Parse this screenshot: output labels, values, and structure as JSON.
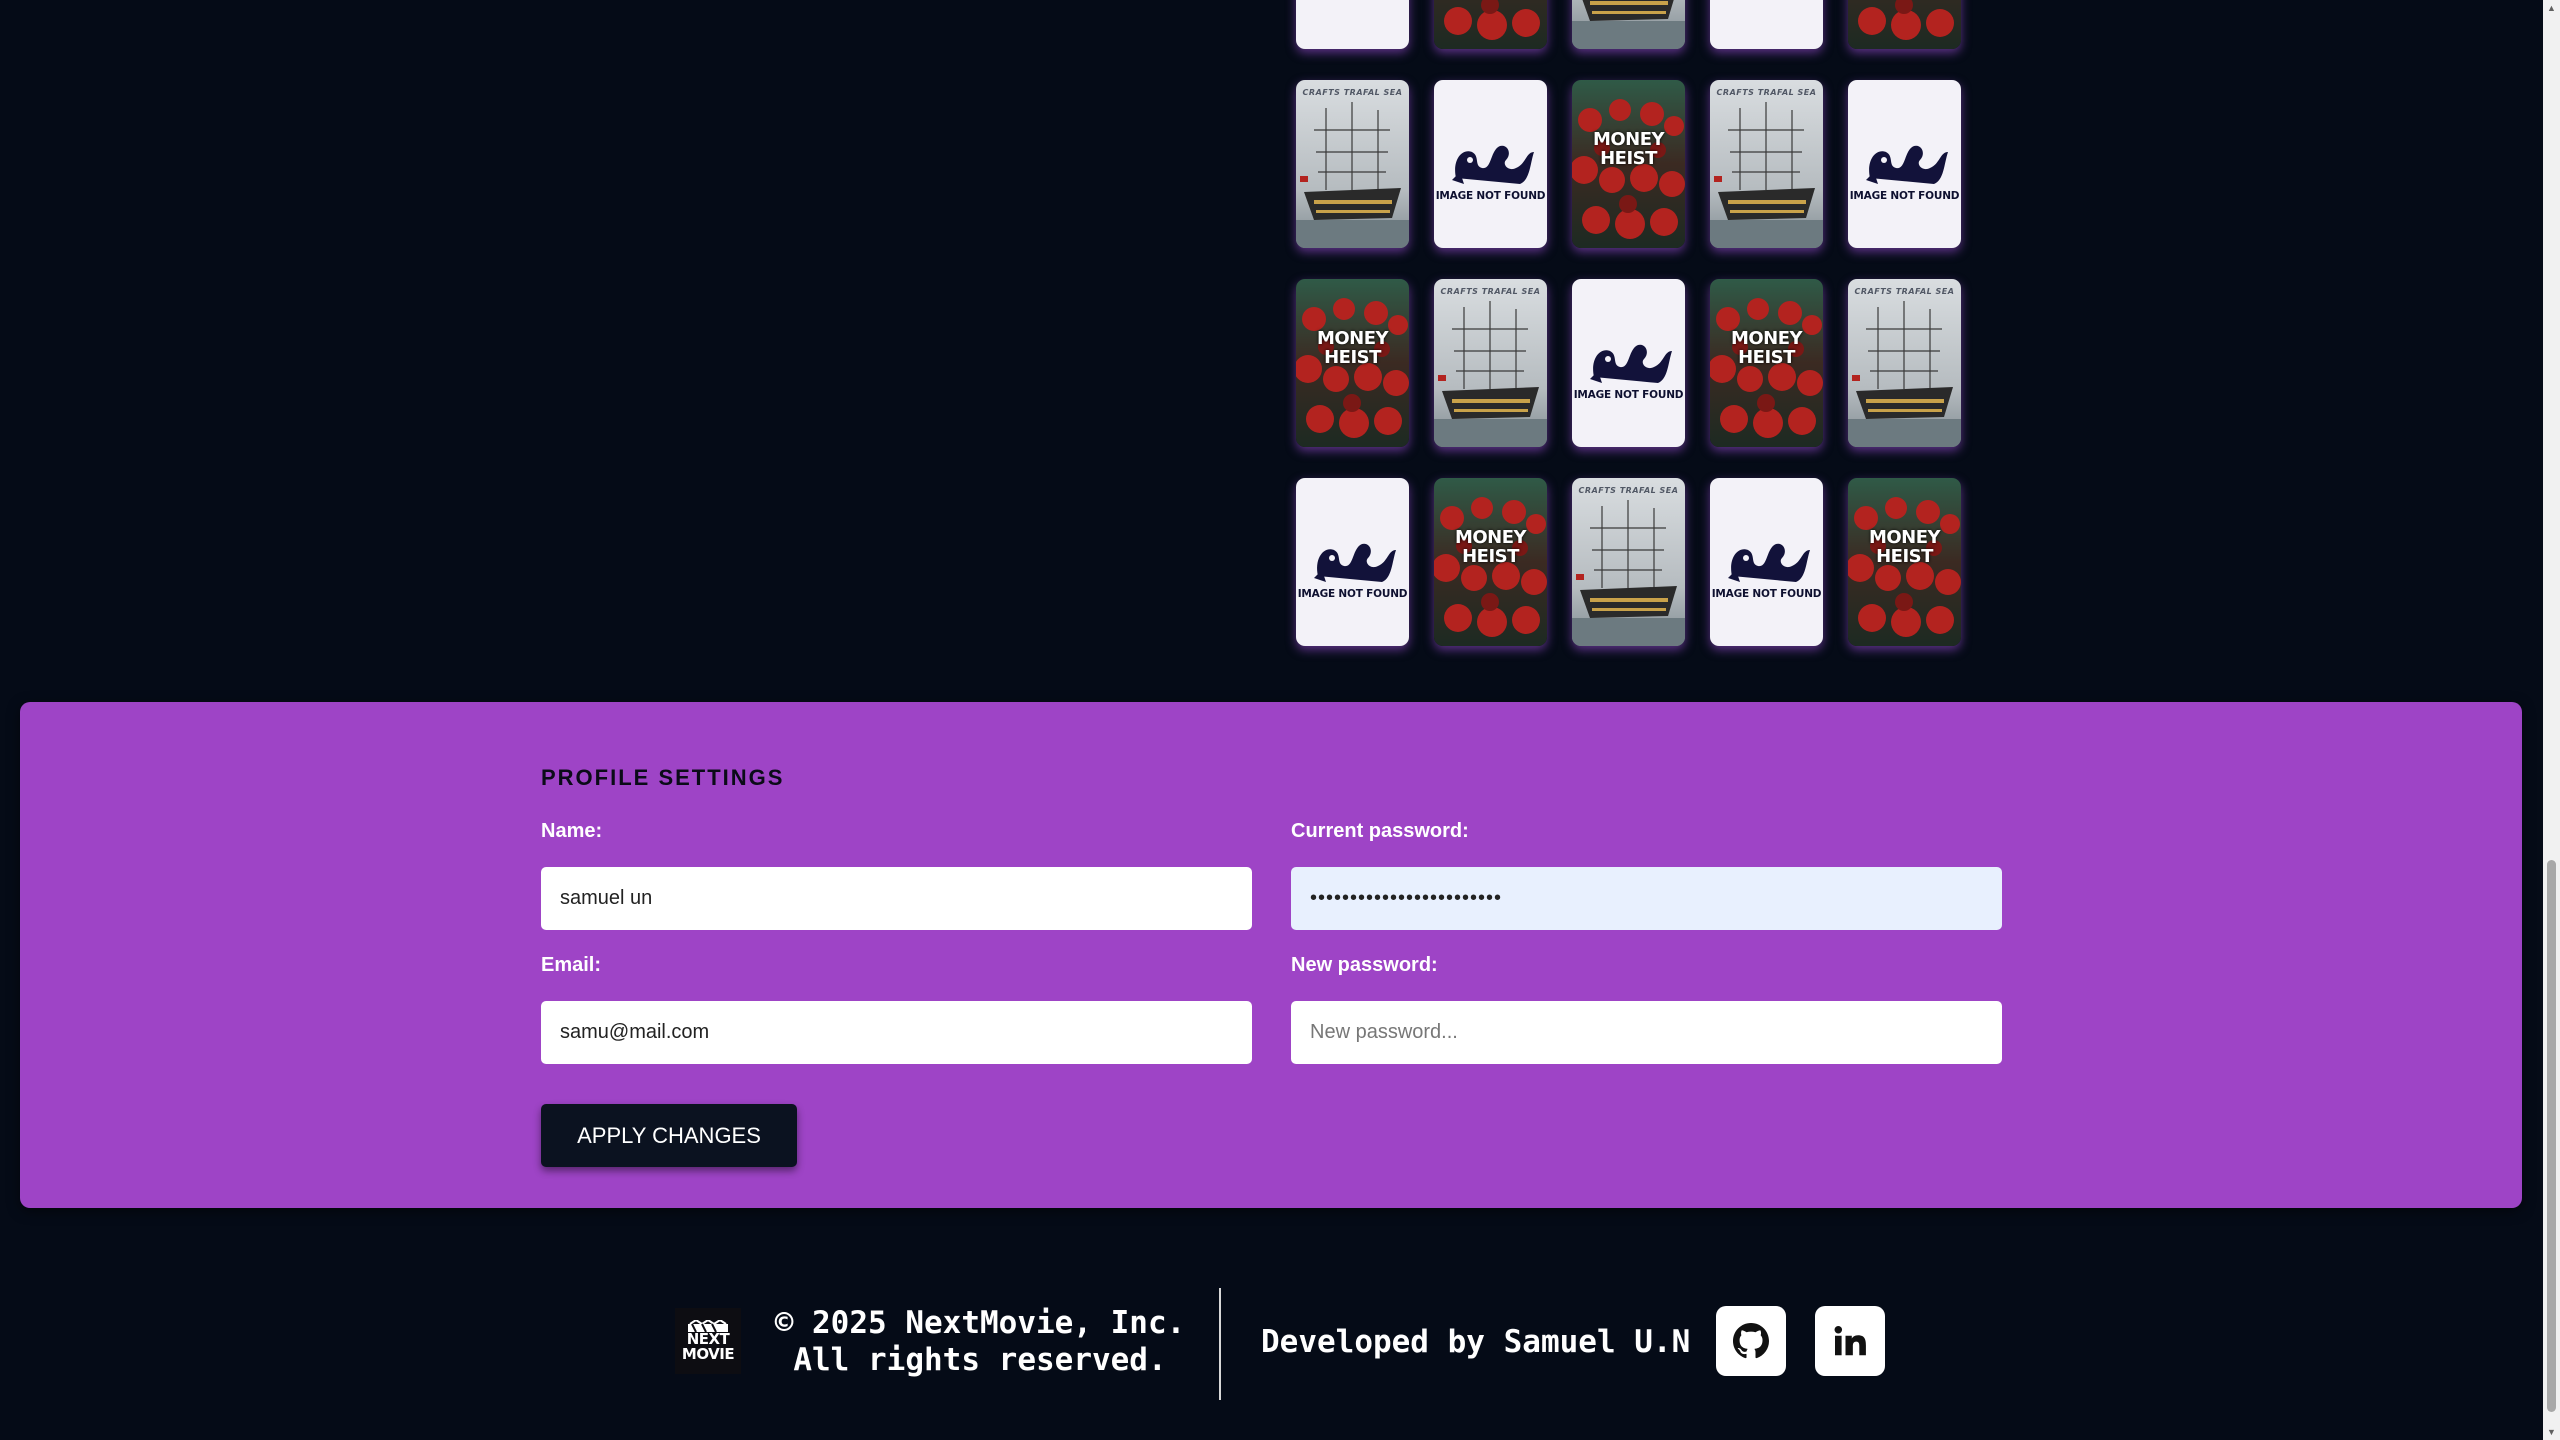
{
  "posters": {
    "rows": [
      [
        "not_found",
        "heist",
        "ship",
        "not_found",
        "heist"
      ],
      [
        "ship",
        "not_found",
        "heist",
        "ship",
        "not_found"
      ],
      [
        "heist",
        "ship",
        "not_found",
        "heist",
        "ship"
      ],
      [
        "not_found",
        "heist",
        "ship",
        "not_found",
        "heist"
      ]
    ],
    "not_found_caption": "IMAGE NOT FOUND",
    "heist_caption_line1": "MONEY",
    "heist_caption_line2": "HEIST",
    "ship_caption": "CRAFTS TRAFAL SEA"
  },
  "settings": {
    "title": "PROFILE SETTINGS",
    "name_label": "Name:",
    "name_value": "samuel un",
    "email_label": "Email:",
    "email_value": "samu@mail.com",
    "current_password_label": "Current password:",
    "current_password_value": "••••••••••••••••••••••••",
    "new_password_label": "New password:",
    "new_password_placeholder": "New password...",
    "apply_label": "APPLY CHANGES"
  },
  "footer": {
    "logo_line1": "NEXT",
    "logo_line2": "MOVIE",
    "copyright_line1": "© 2025 NextMovie, Inc.",
    "copyright_line2": "All rights reserved.",
    "developer_credit": "Developed by Samuel U.N",
    "github_icon": "github-icon",
    "linkedin_icon": "linkedin-icon"
  },
  "colors": {
    "page_background": "#050b17",
    "panel_background": "#9e44c6",
    "button_background": "#0b1220"
  }
}
